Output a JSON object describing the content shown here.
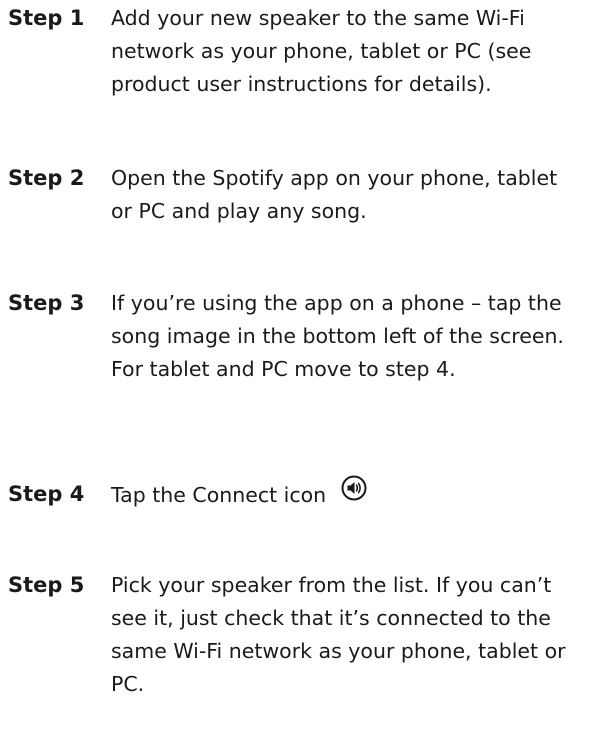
{
  "steps": [
    {
      "label": "Step 1",
      "text": "Add your new speaker to the same Wi-Fi network as your phone, tablet or PC (see product user instructions for details)."
    },
    {
      "label": "Step 2",
      "text": "Open the Spotify app on your phone, tablet or PC and play any song."
    },
    {
      "label": "Step 3",
      "text": "If you’re using the app on a phone – tap the song image in the bottom left of the screen. For tablet and PC move to step 4."
    },
    {
      "label": "Step 4",
      "text": "Tap the Connect icon",
      "icon": "speaker-connect-icon"
    },
    {
      "label": "Step 5",
      "text": "Pick your speaker from the list. If you can’t see it, just check that it’s connected to the same Wi-Fi network as your phone, tablet or PC."
    }
  ]
}
